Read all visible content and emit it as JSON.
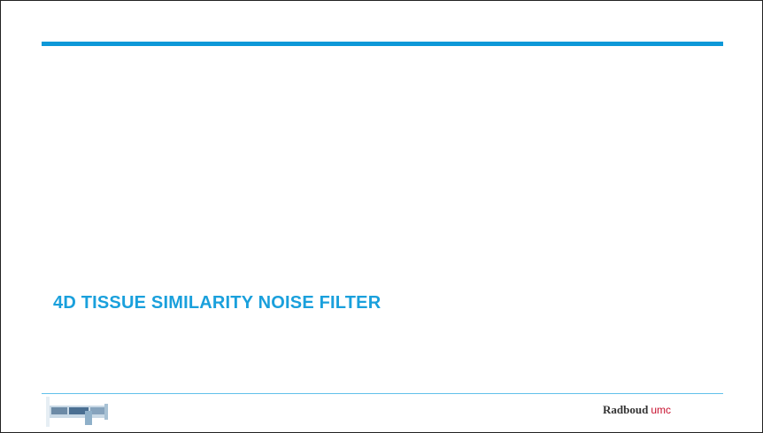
{
  "slide": {
    "title": "4D TISSUE SIMILARITY NOISE FILTER",
    "accent_color": "#0d98d8",
    "title_color": "#1aa0dc"
  },
  "footer": {
    "left_logo_icon": "institute-logo-icon",
    "brand_part1": "Radboud",
    "brand_part2": "umc",
    "brand_part2_color": "#c8102e"
  }
}
